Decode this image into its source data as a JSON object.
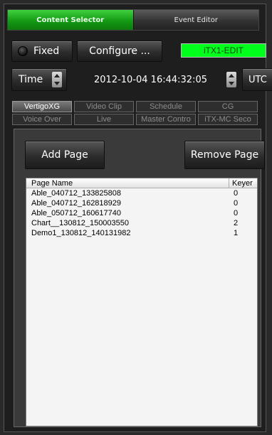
{
  "top_tabs": [
    {
      "label": "Content Selector",
      "active": true
    },
    {
      "label": "Event Editor",
      "active": false
    }
  ],
  "controls": {
    "fixed_label": "Fixed",
    "configure_label": "Configure ...",
    "status_text": "iTX1-EDIT",
    "time_label": "Time",
    "time_value": "2012-10-04 16:44:32:05",
    "utc_label": "UTC"
  },
  "sub_tabs": {
    "row1": [
      "VertigoXG",
      "Video Clip",
      "Schedule",
      "CG"
    ],
    "row2": [
      "Voice Over",
      "Live",
      "Master Contro",
      "iTX-MC Seco"
    ],
    "active": "VertigoXG"
  },
  "page_actions": {
    "add_label": "Add Page",
    "remove_label": "Remove Page"
  },
  "page_list": {
    "columns": [
      "Page Name",
      "Keyer"
    ],
    "rows": [
      {
        "name": "Able_040712_133825808",
        "keyer": "0"
      },
      {
        "name": "Able_040712_162818929",
        "keyer": "0"
      },
      {
        "name": "Able_050712_160617740",
        "keyer": "0"
      },
      {
        "name": "Chart__130812_150003550",
        "keyer": "2"
      },
      {
        "name": "Demo1_130812_140131982",
        "keyer": "1"
      }
    ]
  },
  "colors": {
    "active_tab": "#149a14",
    "status_bg": "#00ff1a",
    "background": "#1e1e1e"
  }
}
